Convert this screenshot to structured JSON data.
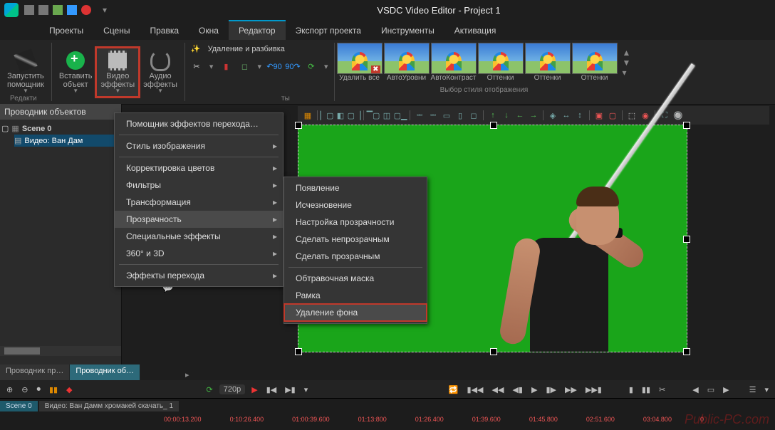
{
  "title": "VSDC Video Editor - Project 1",
  "menu": {
    "items": [
      "Проекты",
      "Сцены",
      "Правка",
      "Окна",
      "Редактор",
      "Экспорт проекта",
      "Инструменты",
      "Активация"
    ],
    "active": 4
  },
  "ribbon": {
    "wizard": "Запустить\nпомощник",
    "insert": "Вставить\nобъект",
    "video_fx": "Видео\nэффекты",
    "audio_fx": "Аудио\nэффекты",
    "section1": "Редакти",
    "section2": "ты",
    "del_split": "Удаление и разбивка",
    "thumbs": [
      "Удалить все",
      "АвтоУровни",
      "АвтоКонтраст",
      "Оттенки",
      "Оттенки",
      "Оттенки"
    ],
    "thumbs_label": "Выбор стиля отображения"
  },
  "left": {
    "header": "Проводник объектов",
    "scene": "Scene 0",
    "video": "Видео: Ван Дам",
    "tab1": "Проводник пр…",
    "tab2": "Проводник об…"
  },
  "ctx1": {
    "items": [
      "Помощник эффектов перехода…",
      "Стиль изображения",
      "Корректировка цветов",
      "Фильтры",
      "Трансформация",
      "Прозрачность",
      "Специальные эффекты",
      "360° и 3D",
      "Эффекты перехода"
    ]
  },
  "ctx2": {
    "items": [
      "Появление",
      "Исчезновение",
      "Настройка прозрачности",
      "Сделать непрозрачным",
      "Сделать прозрачным",
      "Обтравочная маска",
      "Рамка",
      "Удаление фона"
    ]
  },
  "playbar": {
    "res": "720p"
  },
  "timeline": {
    "scene": "Scene 0",
    "clip": "Видео: Ван Дамм хромакей скачать_ 1",
    "marks": [
      "00:00:13.200",
      "0:10:26.400",
      "01:00:39.600",
      "01:13:800",
      "01:26.400",
      "01:39.600",
      "01:45.800",
      "02:51.600",
      "03:04.800",
      "0"
    ]
  },
  "watermark": "Public-PC.com"
}
